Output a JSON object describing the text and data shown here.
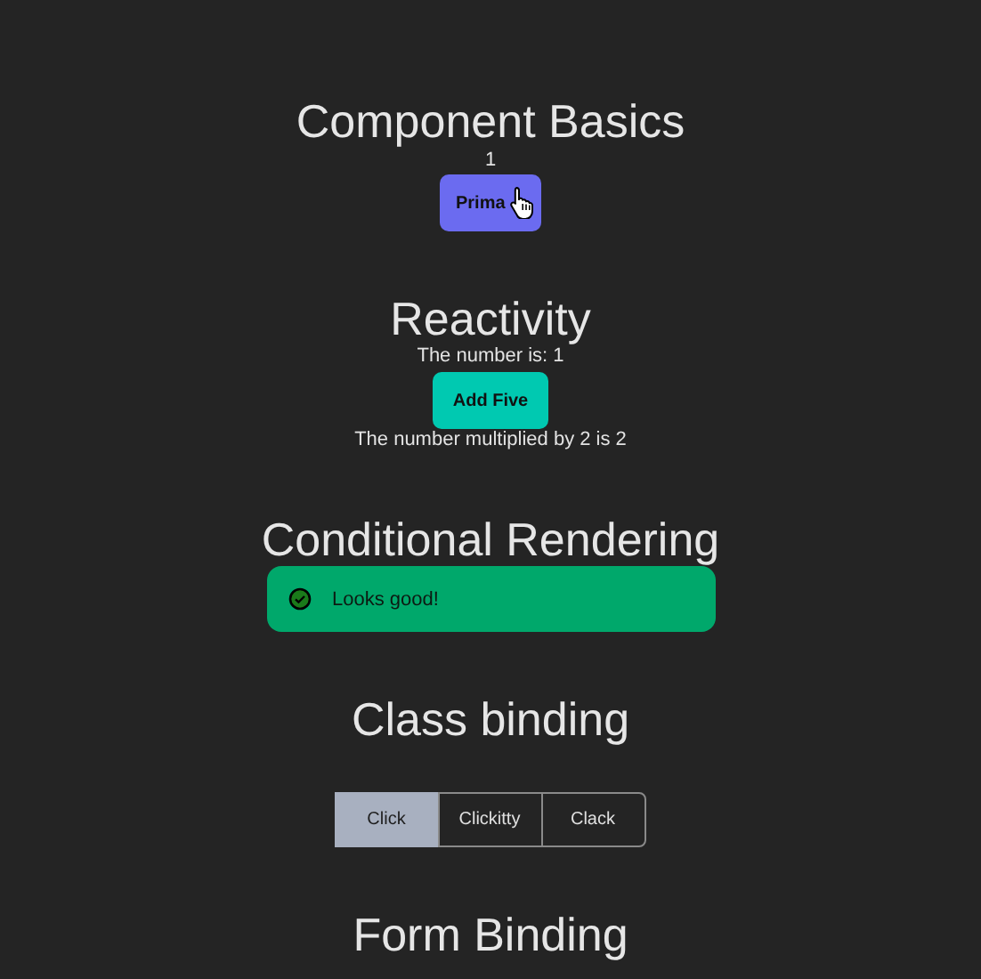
{
  "sections": [
    {
      "kind": "basics",
      "title": "Component Basics",
      "count": "1",
      "button": "Prima"
    },
    {
      "kind": "reactivity",
      "title": "Reactivity",
      "text": "The number is: 1",
      "button": "Add Five",
      "result": "The number multiplied by 2 is 2"
    },
    {
      "kind": "conditional",
      "title": "Conditional Rendering",
      "alert": "Looks good!"
    },
    {
      "kind": "class_binding",
      "title": "Class binding",
      "options": [
        {
          "label": "Click",
          "selected": true
        },
        {
          "label": "Clickitty",
          "selected": false
        },
        {
          "label": "Clack",
          "selected": false
        }
      ]
    },
    {
      "kind": "form",
      "title": "Form Binding"
    }
  ]
}
